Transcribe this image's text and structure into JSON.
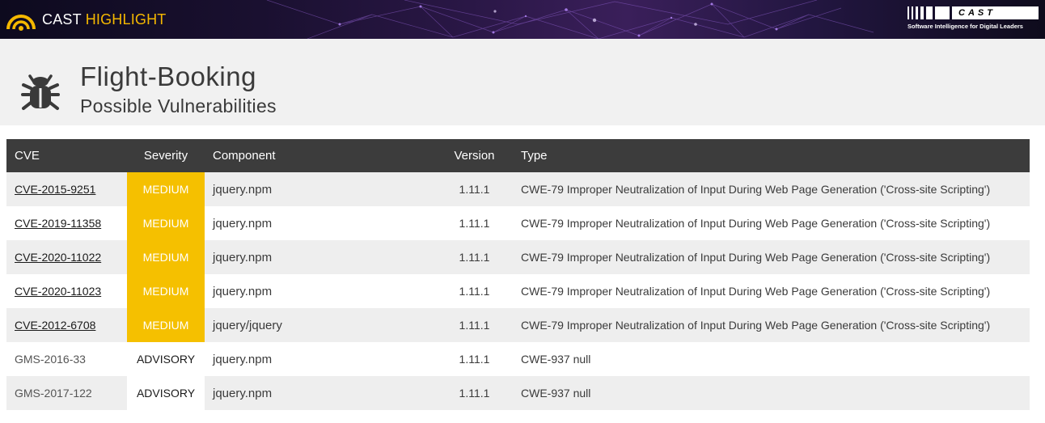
{
  "banner": {
    "brand_part1": "CAST",
    "brand_part2": "HIGHLIGHT",
    "right_logo": "CAST",
    "right_tagline": "Software Intelligence for Digital Leaders",
    "accent_color": "#f5b800"
  },
  "header": {
    "icon": "bug-icon",
    "title": "Flight-Booking",
    "subtitle": "Possible Vulnerabilities"
  },
  "table": {
    "columns": [
      "CVE",
      "Severity",
      "Component",
      "Version",
      "Type"
    ],
    "rows": [
      {
        "cve": "CVE-2015-9251",
        "linked": true,
        "severity": "MEDIUM",
        "component": "jquery.npm",
        "version": "1.11.1",
        "type": "CWE-79 Improper Neutralization of Input During Web Page Generation ('Cross-site Scripting')"
      },
      {
        "cve": "CVE-2019-11358",
        "linked": true,
        "severity": "MEDIUM",
        "component": "jquery.npm",
        "version": "1.11.1",
        "type": "CWE-79 Improper Neutralization of Input During Web Page Generation ('Cross-site Scripting')"
      },
      {
        "cve": "CVE-2020-11022",
        "linked": true,
        "severity": "MEDIUM",
        "component": "jquery.npm",
        "version": "1.11.1",
        "type": "CWE-79 Improper Neutralization of Input During Web Page Generation ('Cross-site Scripting')"
      },
      {
        "cve": "CVE-2020-11023",
        "linked": true,
        "severity": "MEDIUM",
        "component": "jquery.npm",
        "version": "1.11.1",
        "type": "CWE-79 Improper Neutralization of Input During Web Page Generation ('Cross-site Scripting')"
      },
      {
        "cve": "CVE-2012-6708",
        "linked": true,
        "severity": "MEDIUM",
        "component": "jquery/jquery",
        "version": "1.11.1",
        "type": "CWE-79 Improper Neutralization of Input During Web Page Generation ('Cross-site Scripting')"
      },
      {
        "cve": "GMS-2016-33",
        "linked": false,
        "severity": "ADVISORY",
        "component": "jquery.npm",
        "version": "1.11.1",
        "type": "CWE-937 null"
      },
      {
        "cve": "GMS-2017-122",
        "linked": false,
        "severity": "ADVISORY",
        "component": "jquery.npm",
        "version": "1.11.1",
        "type": "CWE-937 null"
      }
    ],
    "severity_colors": {
      "MEDIUM": "#f5c000",
      "ADVISORY": "#ffffff"
    }
  }
}
